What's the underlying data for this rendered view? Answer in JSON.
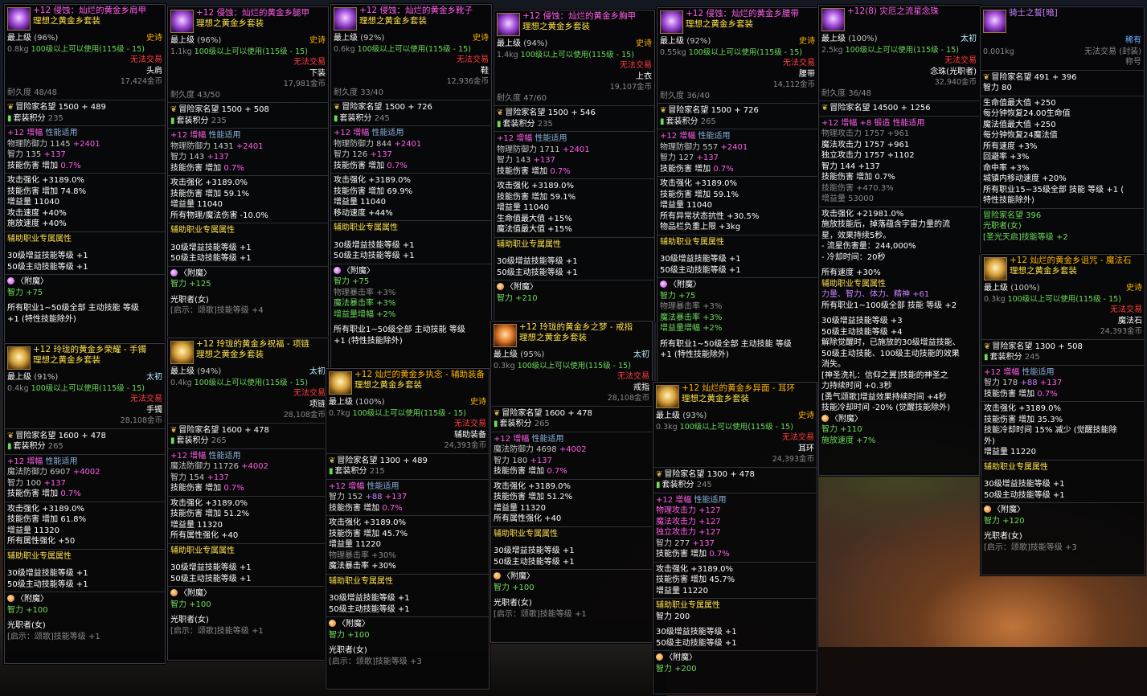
{
  "common": {
    "grade": "最上级",
    "usable": "100级以上可以使用(115级 - 15)",
    "untradable": "无法交易",
    "adv": "冒险家名望",
    "setpts": "套装积分",
    "amp": "+12 增幅",
    "perf": "性能适用",
    "skill_dmg": "技能伤害 增加",
    "skill_dmg_pct": "0.7%",
    "aux": "辅助职业专属属性",
    "s30": "30级增益技能等级 +1",
    "s50": "50级主动技能等级 +1",
    "enchant": "〈附魔〉",
    "job": "光职者(女)",
    "job_skill4": "[启示：颂歌]技能等级 +4",
    "job_skill1": "[启示：颂歌]技能等级 +1",
    "job_skill3": "[启示：颂歌]技能等级 +3",
    "atk_str": "攻击强化 +3189.0%",
    "dur": "耐久度",
    "epic": "史诗"
  },
  "panels": {
    "p1": {
      "name": "+12 侵蚀：灿烂的黄金乡肩甲",
      "set": "理想之黄金乡套装",
      "quality": "(96%)",
      "weight": "0.8kg",
      "slot": "头肩",
      "price": "17,424金币",
      "durability": "48/48",
      "adv_v": "1500 + 489",
      "set_v": "235",
      "def": "物理防御力 1145 ",
      "def_b": "+2401",
      "int": "智力 135 ",
      "int_b": "+137",
      "l1": "技能伤害 增加 74.8%",
      "l2": "增益量 11040",
      "l3": "攻击速度 +40%",
      "l4": "施放速度 +40%",
      "ench": "智力 +75",
      "extra1": "所有职业1~50级全部 主动技能 等级",
      "extra2": "+1 (特性技能除外)"
    },
    "p2": {
      "name": "+12 侵蚀：灿烂的黄金乡腿甲",
      "set": "理想之黄金乡套装",
      "quality": "(96%)",
      "weight": "1.1kg",
      "slot": "下装",
      "price": "17,981金币",
      "durability": "43/50",
      "adv_v": "1500 + 508",
      "set_v": "235",
      "def": "物理防御力 1431 ",
      "def_b": "+2401",
      "int": "智力 143 ",
      "int_b": "+137",
      "l1": "技能伤害 增加 59.1%",
      "l2": "增益量 11040",
      "l3": "所有物理/魔法伤害 -10.0%",
      "ench": "智力 +125"
    },
    "p3": {
      "name": "+12 侵蚀：灿烂的黄金乡靴子",
      "set": "理想之黄金乡套装",
      "quality": "(92%)",
      "weight": "0.6kg",
      "slot": "鞋",
      "price": "12,936金币",
      "durability": "33/40",
      "adv_v": "1500 + 726",
      "set_v": "245",
      "def": "物理防御力 844 ",
      "def_b": "+2401",
      "int": "智力 126 ",
      "int_b": "+137",
      "l1": "技能伤害 增加 69.9%",
      "l2": "增益量 11040",
      "l3": "移动速度 +44%",
      "ench1": "智力 +75",
      "ench2": "物理暴击率 +3%",
      "ench3": "魔法暴击率 +3%",
      "ench4": "增益量增幅 +2%",
      "extra1": "所有职业1~50级全部 主动技能 等级",
      "extra2": "+1 (特性技能除外)"
    },
    "p4": {
      "name": "+12 侵蚀：灿烂的黄金乡胸甲",
      "set": "理想之黄金乡套装",
      "quality": "(94%)",
      "weight": "1.4kg",
      "slot": "上衣",
      "price": "19,107金币",
      "durability": "47/60",
      "adv_v": "1500 + 546",
      "set_v": "235",
      "def": "物理防御力 1711 ",
      "def_b": "+2401",
      "int": "智力 143 ",
      "int_b": "+137",
      "l1": "技能伤害 增加 59.1%",
      "l2": "增益量 11040",
      "l3": "生命值最大值 +15%",
      "l4": "魔法值最大值 +15%",
      "ench": "智力 +210"
    },
    "p5": {
      "name": "+12 侵蚀：灿烂的黄金乡腰带",
      "set": "理想之黄金乡套装",
      "quality": "(92%)",
      "weight": "0.55kg",
      "slot": "腰带",
      "price": "14,112金币",
      "durability": "36/40",
      "adv_v": "1500 + 726",
      "set_v": "265",
      "def": "物理防御力 557 ",
      "def_b": "+2401",
      "int": "智力 127 ",
      "int_b": "+137",
      "l1": "技能伤害 增加 59.1%",
      "l2": "增益量 11040",
      "l3": "所有异常状态抗性 +30.5%",
      "l4": "物品栏负重上限 +3kg",
      "ench1": "智力 +75",
      "ench2": "物理暴击率 +3%",
      "ench3": "魔法暴击率 +3%",
      "ench4": "增益量增幅 +2%",
      "extra1": "所有职业1~50级全部 主动技能 等级",
      "extra2": "+1 (特性技能除外)"
    },
    "p6": {
      "name": "+12(8) 灾厄之流星念珠",
      "quality": "(100%)",
      "grade_name": "太初",
      "weight": "2.5kg",
      "slot": "念珠(光职者)",
      "price": "32,940金币",
      "durability": "36/48",
      "adv_v": "14500 + 1256",
      "amp": "+12 增幅 +8 锻造 性能适用",
      "a1": "物理攻击力 1757 +961",
      "a2": "魔法攻击力 1757 +961",
      "a3": "独立攻击力 1757 +1102",
      "int": "智力 144 +137",
      "l1": "技能伤害 增加 0.7%",
      "l2": "技能伤害 +470.3%",
      "l3": "增益量 53000",
      "l4": "攻击强化 +21981.0%",
      "l5": "施放技能后，掉落蕴含宇宙力量的流",
      "l6": "星，效果持续5秒。",
      "l7": "- 流星伤害量：244,000%",
      "l8": "- 冷却时间：20秒",
      "l9": "所有速度 +30%",
      "stats": "力量、智力、体力、精神 +61",
      "sk1": "所有职业1~100级全部 技能 等级 +2",
      "sk2": "30级增益技能等级 +3",
      "sk3": "50级主动技能等级 +4",
      "sk4": "解除觉醒时，已施放的30级增益技能、",
      "sk5": "50级主动技能、100级主动技能的效果",
      "sk6": "消失。",
      "sk7": "[神圣洗礼：信仰之翼]技能的神圣之",
      "sk8": "力持续时间 +0.3秒",
      "sk9": "[勇气颂歌]增益效果持续时间 +4秒",
      "sk10": "技能冷却时间 -20% (觉醒技能除外)",
      "ench1": "智力 +110",
      "ench2": "施放速度 +7%"
    },
    "p7": {
      "name": "骑士之誓[暗]",
      "rarity": "稀有",
      "trade": "无法交易 (封装)",
      "weight": "0.001kg",
      "slot": "称号",
      "adv_v": "491 + 396",
      "int": "智力 80",
      "l1": "生命值最大值 +250",
      "l2": "每分钟恢复24.00生命值",
      "l3": "魔法值最大值 +250",
      "l4": "每分钟恢复24魔法值",
      "l5": "所有速度 +3%",
      "l6": "回避率 +3%",
      "l7": "命中率 +3%",
      "l8": "城镇内移动速度 +20%",
      "l9": "所有职业15~35级全部 技能 等级 +1 (",
      "l10": "特性技能除外)",
      "adv2": "冒险家名望 396",
      "job": "光职者(女)",
      "skill": "[圣光天启]技能等级 +2"
    },
    "p8": {
      "name": "+12 玲珑的黄金乡荣耀 - 手镯",
      "set": "理想之黄金乡套装",
      "quality": "(91%)",
      "grade_name": "太初",
      "weight": "0.4kg",
      "slot": "手镯",
      "price": "28,108金币",
      "adv_v": "1600 + 478",
      "set_v": "265",
      "def": "魔法防御力 6907 ",
      "def_b": "+4002",
      "int": "智力 100 ",
      "int_b": "+137",
      "l1": "技能伤害 增加 61.8%",
      "l2": "增益量 11320",
      "l3": "所有属性强化 +50",
      "ench": "智力 +100"
    },
    "p9": {
      "name": "+12 玲珑的黄金乡祝福 - 项链",
      "set": "理想之黄金乡套装",
      "quality": "(94%)",
      "grade_name": "太初",
      "weight": "0.4kg",
      "slot": "项链",
      "price": "28,108金币",
      "adv_v": "1600 + 478",
      "set_v": "265",
      "def": "魔法防御力 11726 ",
      "def_b": "+4002",
      "int": "智力 154 ",
      "int_b": "+137",
      "l1": "技能伤害 增加 51.2%",
      "l2": "增益量 11320",
      "l3": "所有属性强化 +40",
      "ench": "智力 +100"
    },
    "p10": {
      "name": "+12 灿烂的黄金乡执念 - 辅助装备",
      "set": "理想之黄金乡套装",
      "quality": "(100%)",
      "weight": "0.7kg",
      "slot": "辅助装备",
      "price": "24,393金币",
      "adv_v": "1300 + 489",
      "set_v": "215",
      "int": "智力 152 ",
      "int_b1": "+88 ",
      "int_b2": "+137",
      "l1": "技能伤害 增加 45.7%",
      "l2": "增益量 11220",
      "l3": "物理暴击率 +30%",
      "l4": "魔法暴击率 +30%",
      "ench": "智力 +100"
    },
    "p11": {
      "name": "+12 玲珑的黄金乡之梦 - 戒指",
      "set": "理想之黄金乡套装",
      "quality": "(95%)",
      "grade_name": "太初",
      "weight": "0.3kg",
      "slot": "戒指",
      "price": "28,108金币",
      "adv_v": "1600 + 478",
      "set_v": "265",
      "def": "魔法防御力 4698 ",
      "def_b": "+4002",
      "int": "智力 180 ",
      "int_b": "+137",
      "l1": "技能伤害 增加 51.2%",
      "l2": "增益量 11320",
      "l3": "所有属性强化 +40",
      "ench": "智力 +100"
    },
    "p12": {
      "name": "+12 灿烂的黄金乡异面 - 耳环",
      "set": "理想之黄金乡套装",
      "quality": "(93%)",
      "weight": "0.3kg",
      "slot": "耳环",
      "price": "24,393金币",
      "adv_v": "1300 + 478",
      "set_v": "245",
      "a1": "物理攻击力 +127",
      "a2": "魔法攻击力 +127",
      "a3": "独立攻击力 +127",
      "int": "智力 277 ",
      "int_b": "+137",
      "l1": "技能伤害 增加 45.7%",
      "l2": "增益量 11220",
      "l3": "智力 200",
      "ench": "智力 +200"
    },
    "p13": {
      "name": "+12 灿烂的黄金乡诅咒 - 魔法石",
      "set": "理想之黄金乡套装",
      "quality": "(100%)",
      "weight": "0.3kg",
      "slot": "魔法石",
      "price": "24,393金币",
      "adv_v": "1300 + 508",
      "set_v": "245",
      "int": "智力 178 ",
      "int_b1": "+88 ",
      "int_b2": "+137",
      "l1": "技能伤害 增加 35.3%",
      "l2": "技能冷却时间 15% 减少 (觉醒技能除",
      "l3": "外)",
      "l4": "增益量 11220",
      "ench": "智力 +120"
    }
  }
}
